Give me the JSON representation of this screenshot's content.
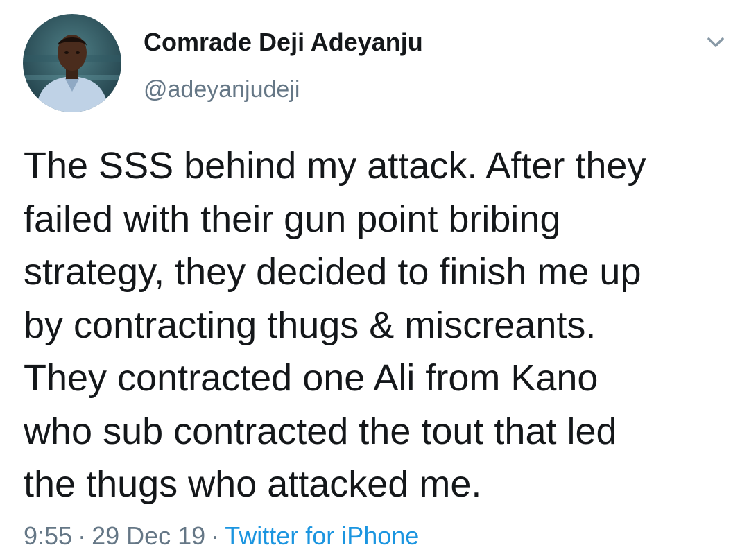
{
  "author": {
    "display_name": "Comrade Deji Adeyanju",
    "handle": "@adeyanjudeji",
    "avatar_icon": "profile-photo"
  },
  "menu": {
    "icon": "chevron-down-icon"
  },
  "tweet": {
    "text": "The SSS behind my attack. After they\nfailed with their gun point bribing\nstrategy, they decided to finish me up\nby contracting thugs & miscreants.\nThey contracted one Ali from Kano\nwho sub contracted the tout that led\nthe thugs who attacked me."
  },
  "meta": {
    "time": "9:55",
    "separator": "·",
    "date": "29 Dec 19",
    "source": "Twitter for iPhone"
  },
  "colors": {
    "text_primary": "#14171a",
    "text_secondary": "#657786",
    "link": "#1b95e0",
    "background": "#ffffff"
  }
}
